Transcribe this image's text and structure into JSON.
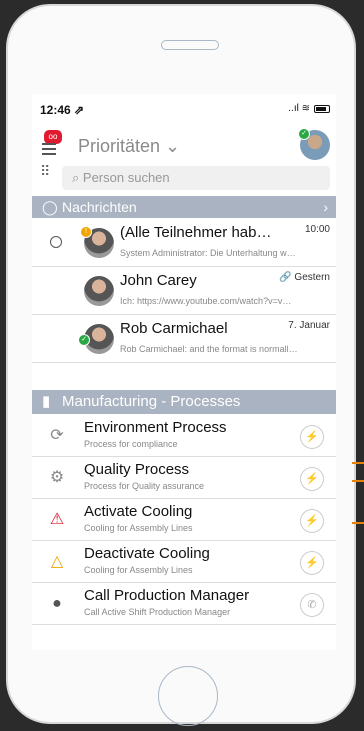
{
  "status": {
    "time": "12:46 ⇗",
    "icons": "..ıl ≋"
  },
  "header": {
    "title": "Prioritäten ⌄",
    "vm_icon": "oo"
  },
  "search": {
    "placeholder": "Person suchen",
    "dial_icon": "⠿"
  },
  "messages_section": {
    "label": "Nachrichten",
    "chevron": "›"
  },
  "messages": [
    {
      "name": "(Alle Teilnehmer hab…",
      "time": "10:00",
      "preview": "System Administrator: Die Unterhaltung w…"
    },
    {
      "name": "John Carey",
      "time": "Gestern",
      "preview": "Ich: https://www.youtube.com/watch?v=v…"
    },
    {
      "name": "Rob Carmichael",
      "time": "7. Januar",
      "preview": "Rob Carmichael: and the format is normall…"
    }
  ],
  "processes_section": {
    "label": "Manufacturing - Processes"
  },
  "actions": [
    {
      "name": "Environment Process",
      "desc": "Process for compliance",
      "icon": "⟳",
      "icon_color": "#888888",
      "btn": "⚡"
    },
    {
      "name": "Quality Process",
      "desc": "Process for Quality assurance",
      "icon": "⚙",
      "icon_color": "#888888",
      "btn": "⚡"
    },
    {
      "name": "Activate Cooling",
      "desc": "Cooling for Assembly Lines",
      "icon": "⚠",
      "icon_color": "#e01b2f",
      "btn": "⚡"
    },
    {
      "name": "Deactivate Cooling",
      "desc": "Cooling for Assembly Lines",
      "icon": "△",
      "icon_color": "#f0a500",
      "btn": "⚡"
    },
    {
      "name": "Call Production Manager",
      "desc": "Call Active Shift Production Manager",
      "icon": "●",
      "icon_color": "#555555",
      "btn": "✆"
    }
  ],
  "colors": {
    "accent": "#e8820c",
    "section_bg": "#a9b3c1",
    "online": "#2aa845"
  }
}
